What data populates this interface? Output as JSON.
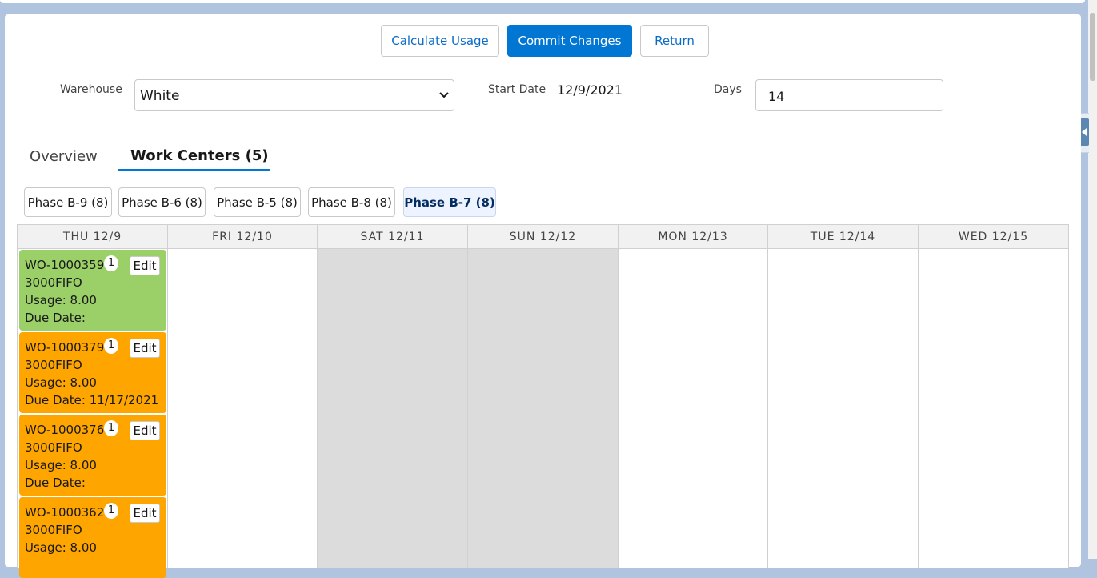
{
  "toolbar": {
    "calculate_label": "Calculate Usage",
    "commit_label": "Commit Changes",
    "return_label": "Return"
  },
  "filters": {
    "warehouse_label": "Warehouse",
    "warehouse_value": "White",
    "start_date_label": "Start Date",
    "start_date_value": "12/9/2021",
    "days_label": "Days",
    "days_value": "14"
  },
  "tabs": [
    {
      "label": "Overview",
      "active": false
    },
    {
      "label": "Work Centers (5)",
      "active": true
    }
  ],
  "phases": [
    {
      "label": "Phase B-9 (8)",
      "active": false
    },
    {
      "label": "Phase B-6 (8)",
      "active": false
    },
    {
      "label": "Phase B-5 (8)",
      "active": false
    },
    {
      "label": "Phase B-8 (8)",
      "active": false
    },
    {
      "label": "Phase B-7 (8)",
      "active": true
    }
  ],
  "calendar": {
    "days": [
      {
        "label": "THU 12/9",
        "weekend": false
      },
      {
        "label": "FRI 12/10",
        "weekend": false
      },
      {
        "label": "SAT 12/11",
        "weekend": true
      },
      {
        "label": "SUN 12/12",
        "weekend": true
      },
      {
        "label": "MON 12/13",
        "weekend": false
      },
      {
        "label": "TUE 12/14",
        "weekend": false
      },
      {
        "label": "WED 12/15",
        "weekend": false
      }
    ],
    "work_orders": [
      {
        "id": "WO-1000359",
        "count": "1",
        "item": "3000FIFO",
        "usage": "Usage: 8.00",
        "due": "Due Date:",
        "color": "#9bd068",
        "edit_label": "Edit"
      },
      {
        "id": "WO-1000379",
        "count": "1",
        "item": "3000FIFO",
        "usage": "Usage: 8.00",
        "due": "Due Date: 11/17/2021",
        "color": "#ffa500",
        "edit_label": "Edit"
      },
      {
        "id": "WO-1000376",
        "count": "1",
        "item": "3000FIFO",
        "usage": "Usage: 8.00",
        "due": "Due Date:",
        "color": "#ffa500",
        "edit_label": "Edit"
      },
      {
        "id": "WO-1000362",
        "count": "1",
        "item": "3000FIFO",
        "usage": "Usage: 8.00",
        "due": "",
        "color": "#ffa500",
        "edit_label": "Edit"
      }
    ]
  },
  "colors": {
    "brand": "#0176d3",
    "on_time": "#9bd068",
    "overdue": "#ffa500",
    "weekend": "#dcdcdc"
  }
}
